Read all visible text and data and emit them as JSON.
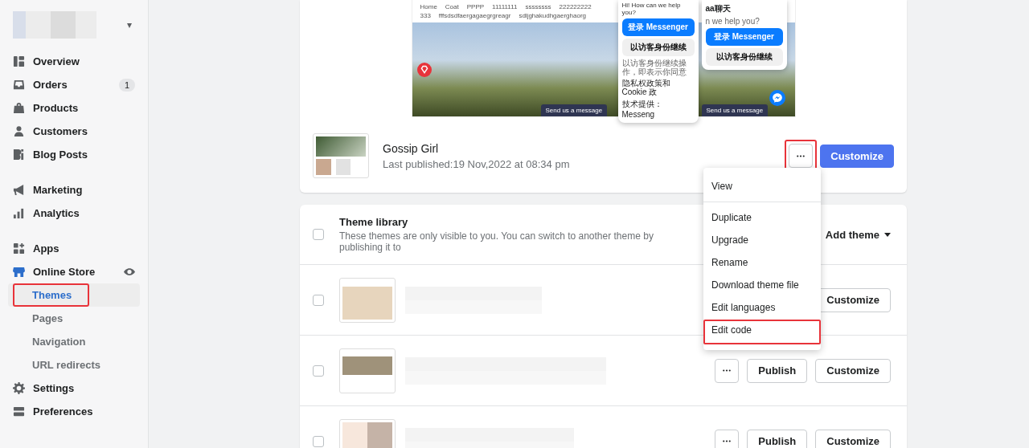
{
  "sidebar": {
    "store_caret": "▾",
    "items": [
      {
        "label": "Overview",
        "selected": false,
        "gap_before": false
      },
      {
        "label": "Orders",
        "selected": false,
        "gap_before": false,
        "badge": "1"
      },
      {
        "label": "Products",
        "selected": false,
        "gap_before": false
      },
      {
        "label": "Customers",
        "selected": false,
        "gap_before": false
      },
      {
        "label": "Blog Posts",
        "selected": false,
        "gap_before": false
      },
      {
        "label": "Marketing",
        "selected": false,
        "gap_before": true
      },
      {
        "label": "Analytics",
        "selected": false,
        "gap_before": false
      },
      {
        "label": "Apps",
        "selected": false,
        "gap_before": true
      },
      {
        "label": "Online Store",
        "selected": true,
        "gap_before": false,
        "eye": true,
        "children": [
          {
            "label": "Themes",
            "selected": true,
            "highlighted": true
          },
          {
            "label": "Pages",
            "selected": false,
            "highlighted": false
          },
          {
            "label": "Navigation",
            "selected": false,
            "highlighted": false
          },
          {
            "label": "URL redirects",
            "selected": false,
            "highlighted": false
          }
        ]
      },
      {
        "label": "Settings",
        "selected": false,
        "gap_before": false
      },
      {
        "label": "Preferences",
        "selected": false,
        "gap_before": false
      }
    ]
  },
  "current_theme": {
    "preview": {
      "nav": [
        "Home",
        "Coat",
        "PPPP",
        "11111111",
        "ssssssss",
        "222222222",
        "333",
        "fffsdsdfaergagaegrgreagr",
        "sdljghakudhgaerghaorg"
      ],
      "popup_left": {
        "greeting": "Hi! How can we help you?",
        "login": "登录 Messenger",
        "guest": "以访客身份继续",
        "legal": "以访客身份继续操作，即表示你同意",
        "legal_links": "隐私权政策和Cookie 政",
        "powered": "技术提供：Messeng"
      },
      "popup_right": {
        "title": "aa聊天",
        "subtitle": "n we help you?",
        "login": "登录 Messenger",
        "guest": "以访客身份继续"
      },
      "send_bars": [
        "Send us a message",
        "Send us a message"
      ]
    },
    "name": "Gossip Girl",
    "published": "Last published:19 Nov,2022 at 08:34 pm",
    "more_highlighted": true,
    "customize": "Customize",
    "menu": {
      "sections": [
        [
          {
            "label": "View",
            "highlighted": false
          }
        ],
        [
          {
            "label": "Duplicate",
            "highlighted": false
          },
          {
            "label": "Upgrade",
            "highlighted": false
          },
          {
            "label": "Rename",
            "highlighted": false
          },
          {
            "label": "Download theme file",
            "highlighted": false
          },
          {
            "label": "Edit languages",
            "highlighted": false
          },
          {
            "label": "Edit code",
            "highlighted": true
          }
        ]
      ]
    }
  },
  "library": {
    "title": "Theme library",
    "subtitle": "These themes are only visible to you. You can switch to another theme by publishing it to",
    "add_theme": "Add theme",
    "checked": false,
    "rows": [
      {
        "checked": false,
        "buttons": [
          {
            "kind": "customize",
            "label": "Customize"
          }
        ]
      },
      {
        "checked": false,
        "buttons": [
          {
            "kind": "more"
          },
          {
            "kind": "publish",
            "label": "Publish"
          },
          {
            "kind": "customize",
            "label": "Customize"
          }
        ]
      },
      {
        "checked": false,
        "buttons": [
          {
            "kind": "more"
          },
          {
            "kind": "publish",
            "label": "Publish"
          },
          {
            "kind": "customize",
            "label": "Customize"
          }
        ]
      }
    ]
  }
}
